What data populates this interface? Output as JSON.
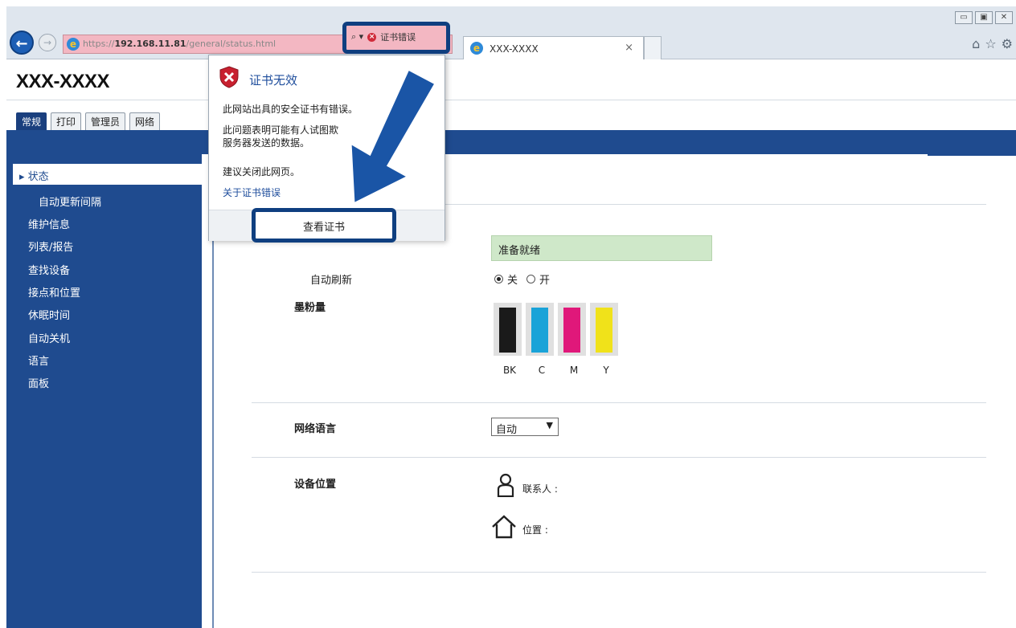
{
  "browser": {
    "window_controls": [
      "▭",
      "▣",
      "✕"
    ],
    "url_scheme": "https://",
    "url_host": "192.168.11.81",
    "url_path": "/general/status.html",
    "search_glyph": "⌕ ▾",
    "cert_error_label": "证书错误",
    "tab_title": "XXX-XXXX",
    "tab_close": "×",
    "toolbar_icons": [
      "⌂",
      "☆",
      "⚙"
    ]
  },
  "page": {
    "brand": "XXX-XXXX",
    "tabs": [
      "常规",
      "打印",
      "管理员",
      "网络"
    ],
    "sidebar": {
      "active": "▸ 状态",
      "sub_item": "自动更新间隔",
      "items": [
        "维护信息",
        "列表/报告",
        "查找设备",
        "接点和位置",
        "休眠时间",
        "自动关机",
        "语言",
        "面板"
      ]
    },
    "status": {
      "device_status_value": "准备就绪",
      "auto_refresh_label": "自动刷新",
      "radio_off": "关",
      "radio_on": "开"
    },
    "toner": {
      "label": "墨粉量",
      "colors": [
        "#1a1a1a",
        "#1aa3d8",
        "#e0187a",
        "#f0e21a"
      ],
      "names": [
        "BK",
        "C",
        "M",
        "Y"
      ]
    },
    "web_language": {
      "label": "网络语言",
      "value": "自动",
      "arrow": "▼"
    },
    "device_location": {
      "label": "设备位置",
      "contact": "联系人 :",
      "location": "位置 :"
    }
  },
  "popup": {
    "title": "证书无效",
    "line1": "此网站出具的安全证书有错误。",
    "line2a": "此问题表明可能有人试图欺",
    "line2b": "服务器发送的数据。",
    "line3": "建议关闭此网页。",
    "link": "关于证书错误",
    "button": "查看证书"
  },
  "accent_colors": {
    "nav_blue": "#1f4b8f",
    "highlight_border": "#0f3f80",
    "error_red": "#d02b3a"
  }
}
